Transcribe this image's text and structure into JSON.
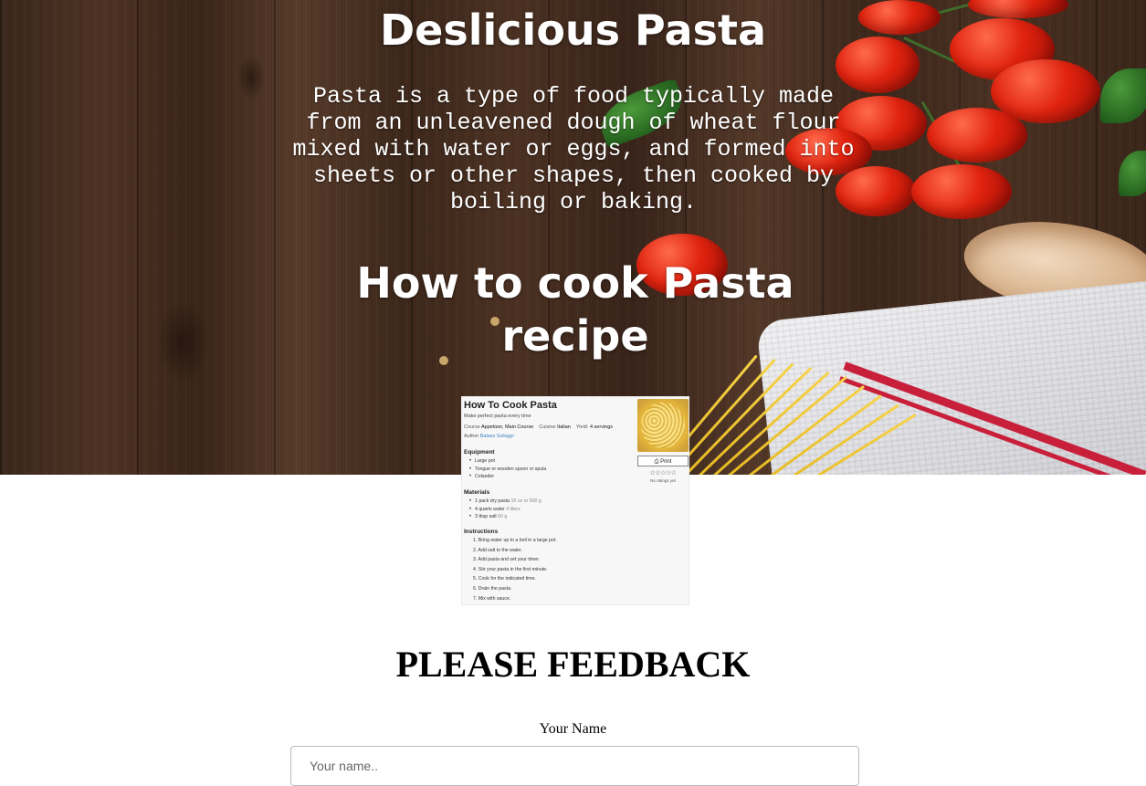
{
  "hero": {
    "title": "Deslicious Pasta",
    "intro": "Pasta is a type of food typically made from an unleavened dough of wheat flour mixed with water or eggs, and formed into sheets or other shapes, then cooked by boiling or baking.",
    "subtitle": "How to cook Pasta recipe"
  },
  "recipe_card": {
    "title": "How To Cook Pasta",
    "description": "Make perfect pasta every time",
    "course_label": "Course",
    "course": "Appetizer, Main Course",
    "cuisine_label": "Cuisine",
    "cuisine": "Italian",
    "yield_label": "Yield:",
    "yield": "4 servings",
    "author_label": "Author",
    "author": "Balazs Szilagyi",
    "print_label": "Print",
    "stars": "☆☆☆☆☆",
    "rating_text": "No ratings yet",
    "equipment_heading": "Equipment",
    "equipment": [
      "Large pot",
      "Tongue or wooden spoon or spula",
      "Colander"
    ],
    "materials_heading": "Materials",
    "materials": [
      {
        "item": "1 pack dry pasta",
        "amount": "16 oz or 500 g"
      },
      {
        "item": "4 quarts water",
        "amount": "4 liters"
      },
      {
        "item": "3 tbsp salt",
        "amount": "60 g"
      }
    ],
    "instructions_heading": "Instructions",
    "instructions": [
      "1. Bring water up to a boil in a large pot.",
      "2. Add salt to the water.",
      "3. Add pasta and set your timer.",
      "4. Stir your pasta in the first minute.",
      "5. Cook for the indicated time.",
      "6. Drain the pasta.",
      "7. Mix with sauce."
    ]
  },
  "feedback": {
    "title": "PLEASE FEEDBACK",
    "name_label": "Your Name",
    "name_placeholder": "Your name.."
  }
}
